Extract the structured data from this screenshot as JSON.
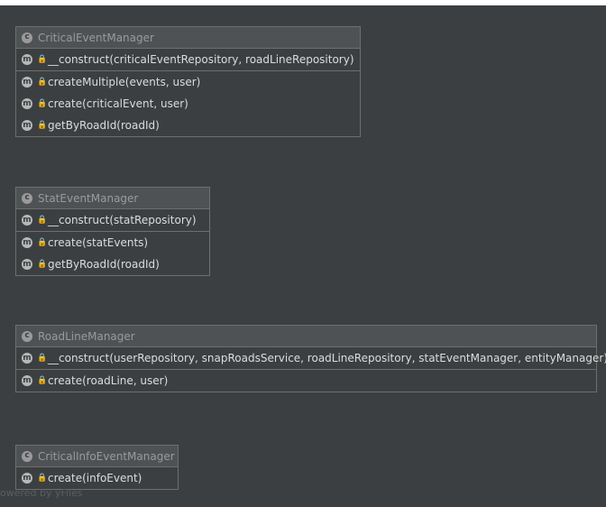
{
  "diagram": {
    "classes": [
      {
        "name": "CriticalEventManager",
        "constructor": "__construct(criticalEventRepository, roadLineRepository)",
        "methods": [
          "createMultiple(events, user)",
          "create(criticalEvent, user)",
          "getByRoadId(roadId)"
        ]
      },
      {
        "name": "StatEventManager",
        "constructor": "__construct(statRepository)",
        "methods": [
          "create(statEvents)",
          "getByRoadId(roadId)"
        ]
      },
      {
        "name": "RoadLineManager",
        "constructor": "__construct(userRepository, snapRoadsService, roadLineRepository, statEventManager, entityManager)",
        "methods": [
          "create(roadLine, user)"
        ]
      },
      {
        "name": "CriticalInfoEventManager",
        "methods": [
          "create(infoEvent)"
        ]
      }
    ],
    "badges": {
      "class": "c",
      "method": "m"
    },
    "icons": {
      "class": "class-icon",
      "method": "method-icon",
      "visibility": "lock-icon"
    },
    "watermark": "owered by yFiles"
  }
}
